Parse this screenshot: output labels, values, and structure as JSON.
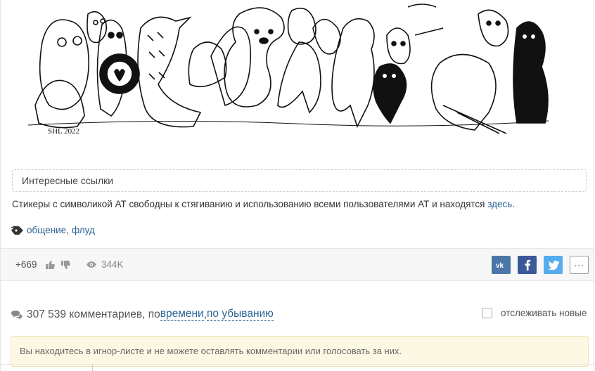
{
  "illustration": {
    "signature": "SHL 2022"
  },
  "spoiler": {
    "label": "Интересные ссылки"
  },
  "post": {
    "text": "Стикеры с символикой АТ свободны к стягиванию и использованию всеми пользователями АТ и находятся ",
    "link_label": "здесь",
    "end": "."
  },
  "tags": {
    "icon": "tag-icon",
    "items": [
      "общение",
      "флуд"
    ],
    "separator": ","
  },
  "stats": {
    "score": "+669",
    "views": "344K"
  },
  "share": {
    "vk": "vk-icon",
    "facebook": "facebook-icon",
    "twitter": "twitter-icon",
    "more": "..."
  },
  "comments": {
    "count_label": "307 539 комментариев, по ",
    "sort_by": "времени",
    "sep": ", ",
    "order": "по убыванию",
    "follow_label": "отслеживать новые"
  },
  "notice": {
    "text": "Вы находитесь в игнор-листе и не можете оставлять комментарии или голосовать за них."
  }
}
